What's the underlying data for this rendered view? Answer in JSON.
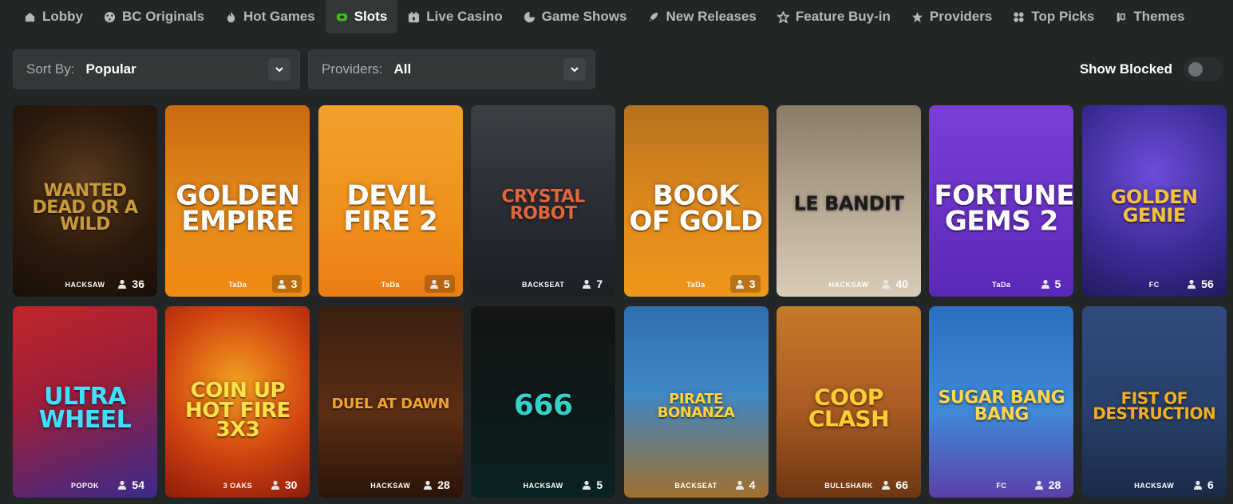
{
  "nav": [
    {
      "label": "Lobby",
      "icon": "home-icon"
    },
    {
      "label": "BC Originals",
      "icon": "originals-icon"
    },
    {
      "label": "Hot Games",
      "icon": "flame-icon"
    },
    {
      "label": "Slots",
      "icon": "slots-icon",
      "active": true
    },
    {
      "label": "Live Casino",
      "icon": "live-casino-icon"
    },
    {
      "label": "Game Shows",
      "icon": "game-shows-icon"
    },
    {
      "label": "New Releases",
      "icon": "rocket-icon"
    },
    {
      "label": "Feature Buy-in",
      "icon": "star-outline-icon"
    },
    {
      "label": "Providers",
      "icon": "star-icon"
    },
    {
      "label": "Top Picks",
      "icon": "grid-icon"
    },
    {
      "label": "Themes",
      "icon": "themes-icon"
    }
  ],
  "filters": {
    "sort_label": "Sort By:",
    "sort_value": "Popular",
    "providers_label": "Providers:",
    "providers_value": "All",
    "show_blocked_label": "Show Blocked",
    "show_blocked_on": false
  },
  "colors": {
    "accent": "#3bc117",
    "background": "#232626",
    "panel": "#323738"
  },
  "games": [
    {
      "title": "WANTED DEAD OR A WILD",
      "provider": "HACKSAW",
      "players": "36"
    },
    {
      "title": "GOLDEN EMPIRE",
      "provider": "TaDa",
      "players": "3"
    },
    {
      "title": "DEVIL FIRE 2",
      "provider": "TaDa",
      "players": "5"
    },
    {
      "title": "CRYSTAL ROBOT",
      "provider": "BACKSEAT",
      "players": "7"
    },
    {
      "title": "BOOK OF GOLD",
      "provider": "TaDa",
      "players": "3"
    },
    {
      "title": "LE BANDIT",
      "provider": "HACKSAW",
      "players": "40"
    },
    {
      "title": "FORTUNE GEMS 2",
      "provider": "TaDa",
      "players": "5"
    },
    {
      "title": "GOLDEN GENIE",
      "provider": "FC",
      "players": "56"
    },
    {
      "title": "ULTRA WHEEL",
      "provider": "POPOK",
      "players": "54"
    },
    {
      "title": "COIN UP HOT FIRE 3x3",
      "provider": "3 OAKS",
      "players": "30"
    },
    {
      "title": "DUEL AT DAWN",
      "provider": "HACKSAW",
      "players": "28"
    },
    {
      "title": "666",
      "provider": "HACKSAW",
      "players": "5"
    },
    {
      "title": "PIRATE BONANZA",
      "provider": "BACKSEAT",
      "players": "4"
    },
    {
      "title": "COOP CLASH",
      "provider": "BULLSHARK",
      "players": "66"
    },
    {
      "title": "SUGAR BANG BANG",
      "provider": "FC",
      "players": "28"
    },
    {
      "title": "FIST OF DESTRUCTION",
      "provider": "HACKSAW",
      "players": "6"
    }
  ]
}
